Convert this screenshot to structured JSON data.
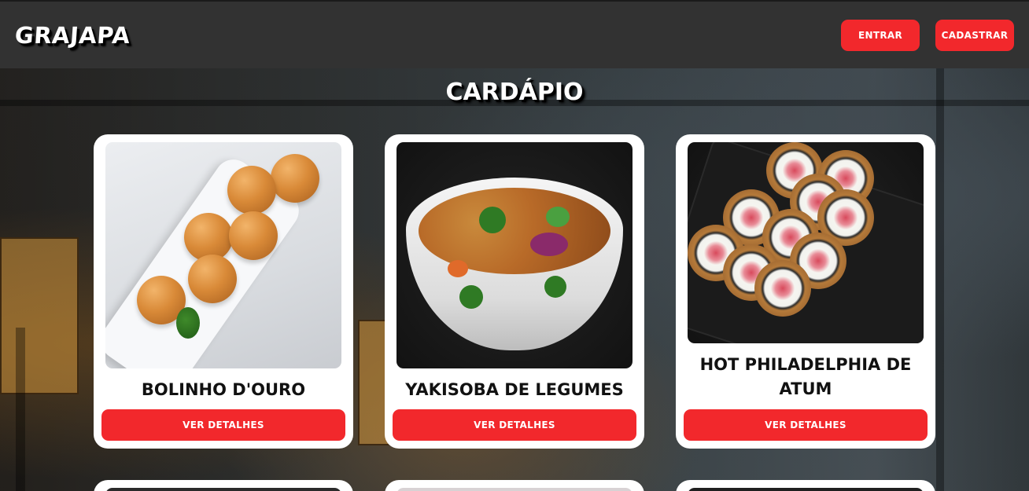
{
  "header": {
    "logo": "GRAJAPA",
    "login_label": "ENTRAR",
    "signup_label": "CADASTRAR"
  },
  "page": {
    "title": "CARDÁPIO"
  },
  "menu": {
    "items": [
      {
        "name": "BOLINHO D'OURO",
        "button": "VER DETALHES"
      },
      {
        "name": "YAKISOBA DE LEGUMES",
        "button": "VER DETALHES"
      },
      {
        "name": "HOT PHILADELPHIA DE ATUM",
        "button": "VER DETALHES"
      }
    ]
  },
  "colors": {
    "header_bg": "#323232",
    "accent_red": "#f2282c",
    "card_bg": "#ffffff"
  }
}
